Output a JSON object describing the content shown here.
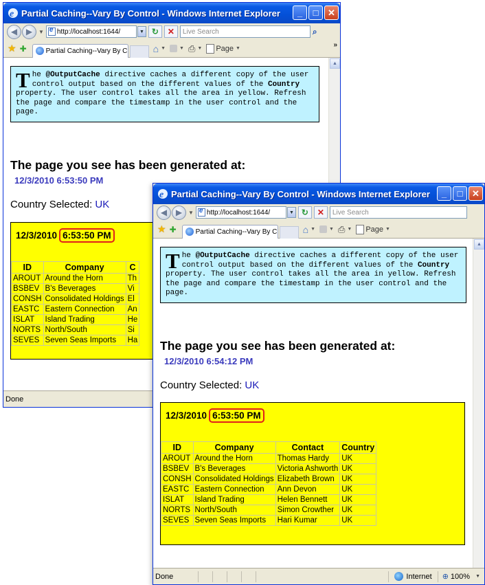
{
  "window": {
    "title": "Partial Caching--Vary By Control - Windows Internet Explorer",
    "url": "http://localhost:1644/",
    "search_placeholder": "Live Search",
    "tab_label": "Partial Caching--Vary By C...",
    "page_menu": "Page",
    "status_done": "Done",
    "status_zone": "Internet",
    "zoom": "100%"
  },
  "page": {
    "drop_cap": "T",
    "info_1": "he ",
    "info_directive": "@OutputCache",
    "info_2": " directive caches a different copy of the user control output based on the different values of the ",
    "info_property": "Country",
    "info_3": " property. The user control takes all the area in yellow. Refresh the page and compare the timestamp in the user control and the page.",
    "generated_heading": "The page you see has been generated at:",
    "country_label": "Country Selected: ",
    "country_value": "UK",
    "grid_headers": [
      "ID",
      "Company",
      "Contact",
      "Country"
    ],
    "rows": [
      {
        "id": "AROUT",
        "company": "Around the Horn",
        "contact": "Thomas Hardy",
        "country": "UK"
      },
      {
        "id": "BSBEV",
        "company": "B's Beverages",
        "contact": "Victoria Ashworth",
        "country": "UK"
      },
      {
        "id": "CONSH",
        "company": "Consolidated Holdings",
        "contact": "Elizabeth Brown",
        "country": "UK"
      },
      {
        "id": "EASTC",
        "company": "Eastern Connection",
        "contact": "Ann Devon",
        "country": "UK"
      },
      {
        "id": "ISLAT",
        "company": "Island Trading",
        "contact": "Helen Bennett",
        "country": "UK"
      },
      {
        "id": "NORTS",
        "company": "North/South",
        "contact": "Simon Crowther",
        "country": "UK"
      },
      {
        "id": "SEVES",
        "company": "Seven Seas Imports",
        "contact": "Hari Kumar",
        "country": "UK"
      }
    ],
    "back_truncated_contacts": [
      "Th",
      "Vi",
      "El",
      "An",
      "He",
      "Si",
      "Ha"
    ]
  },
  "back": {
    "page_date": "12/3/2010 6:53:50 PM",
    "uc_date": "12/3/2010",
    "uc_time": "6:53:50 PM"
  },
  "front": {
    "page_date": "12/3/2010 6:54:12 PM",
    "uc_date": "12/3/2010",
    "uc_time": "6:53:50 PM"
  },
  "colors": {
    "info_bg": "#bff2ff",
    "user_control_bg": "#ffff00",
    "highlight_circle": "#e0201a",
    "timestamp_blue": "#3b3bbd"
  }
}
